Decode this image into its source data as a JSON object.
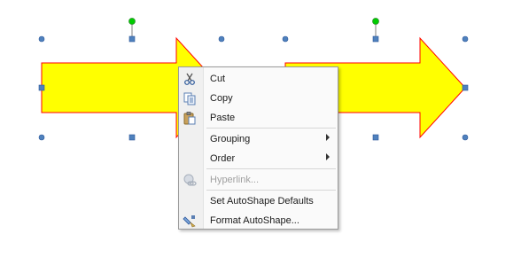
{
  "menu": {
    "items": [
      {
        "label": "Cut",
        "icon": "scissors-icon",
        "enabled": true
      },
      {
        "label": "Copy",
        "icon": "copy-icon",
        "enabled": true
      },
      {
        "label": "Paste",
        "icon": "paste-icon",
        "enabled": true
      },
      {
        "label": "Grouping",
        "submenu": true,
        "enabled": true
      },
      {
        "label": "Order",
        "submenu": true,
        "enabled": true
      },
      {
        "label": "Hyperlink...",
        "icon": "hyperlink-icon",
        "enabled": false
      },
      {
        "label": "Set AutoShape Defaults",
        "enabled": true
      },
      {
        "label": "Format AutoShape...",
        "icon": "format-shape-icon",
        "enabled": true
      }
    ]
  },
  "colors": {
    "arrow_fill": "#ffff00",
    "arrow_stroke": "#ff0000",
    "handle": "#4f81bd",
    "rotate_handle": "#00cc00"
  }
}
